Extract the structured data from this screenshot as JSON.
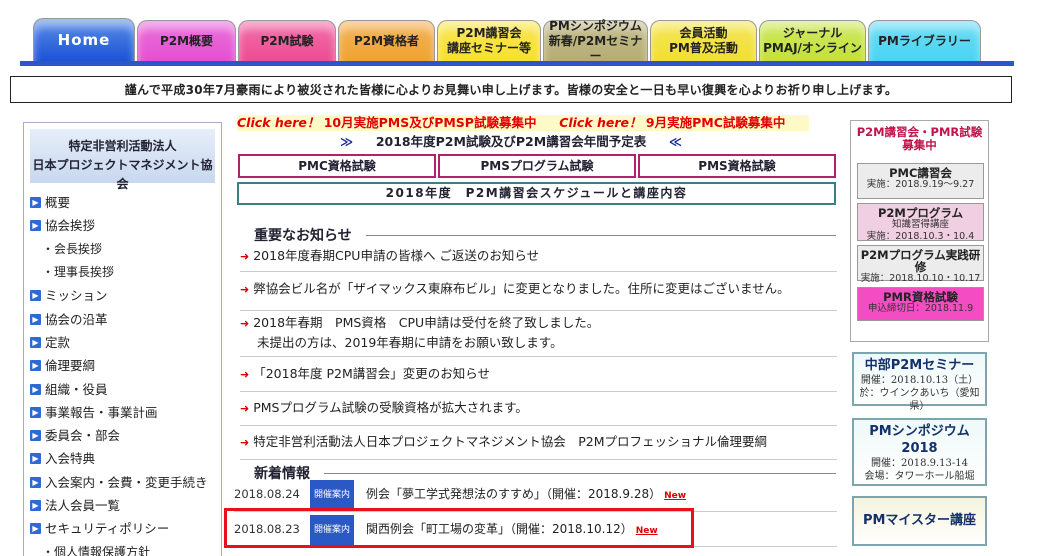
{
  "nav": {
    "tabs": [
      {
        "l1": "Home",
        "l2": "",
        "color": "#1c52d6"
      },
      {
        "l1": "P2M概要",
        "l2": "",
        "color": "#e44fd2"
      },
      {
        "l1": "P2M試験",
        "l2": "",
        "color": "#ee4c93"
      },
      {
        "l1": "P2M資格者",
        "l2": "",
        "color": "#f0a232"
      },
      {
        "l1": "P2M講習会",
        "l2": "講座セミナー等",
        "color": "#f7e02d"
      },
      {
        "l1": "PMシンポジウム",
        "l2": "新春/P2Mセミナー",
        "color": "#b6ad74"
      },
      {
        "l1": "会員活動",
        "l2": "PM普及活動",
        "color": "#f2df32"
      },
      {
        "l1": "ジャーナル",
        "l2": "PMAJ/オンライン",
        "color": "#c2e23a"
      },
      {
        "l1": "PMライブラリー",
        "l2": "",
        "color": "#49d4f3"
      }
    ]
  },
  "notice": "謹んで平成30年7月豪雨により被災された皆様に心よりお見舞い申し上げます。皆様の安全と一日も早い復興を心よりお祈り申し上げます。",
  "sidebar": {
    "org1": "特定非営利活動法人",
    "org2": "日本プロジェクトマネジメント協会",
    "items": [
      {
        "label": "概要",
        "sub": false
      },
      {
        "label": "協会挨拶",
        "sub": false
      },
      {
        "label": "・会長挨拶",
        "sub": true
      },
      {
        "label": "・理事長挨拶",
        "sub": true
      },
      {
        "label": "ミッション",
        "sub": false
      },
      {
        "label": "協会の沿革",
        "sub": false
      },
      {
        "label": "定款",
        "sub": false
      },
      {
        "label": "倫理要綱",
        "sub": false
      },
      {
        "label": "組織・役員",
        "sub": false
      },
      {
        "label": "事業報告・事業計画",
        "sub": false
      },
      {
        "label": "委員会・部会",
        "sub": false
      },
      {
        "label": "入会特典",
        "sub": false
      },
      {
        "label": "入会案内・会費・変更手続き",
        "sub": false
      },
      {
        "label": "法人会員一覧",
        "sub": false
      },
      {
        "label": "セキュリティポリシー",
        "sub": false
      },
      {
        "label": "・個人情報保護方針",
        "sub": true
      }
    ]
  },
  "center": {
    "click1": "Click here！",
    "click1_text": "10月実施PMS及びPMSP試験募集中",
    "click2": "Click here！",
    "click2_text": "9月実施PMC試験募集中",
    "schedule": "2018年度P2M試験及びP2M講習会年間予定表",
    "exams": [
      "PMC資格試験",
      "PMSプログラム試験",
      "PMS資格試験"
    ],
    "schedbar": "2018年度　P2M講習会スケジュールと講座内容",
    "important_title": "重要なお知らせ",
    "important": [
      [
        "2018年度春期CPU申請の皆様へ ご返送のお知らせ"
      ],
      [
        "弊協会ビル名が「ザイマックス東麻布ビル」に変更となりました。住所に変更はございません。"
      ],
      [
        "2018年春期　PMS資格　CPU申請は受付を終了致しました。",
        "未提出の方は、2019年春期に申請をお願い致します。"
      ],
      [
        "「2018年度 P2M講習会」変更のお知らせ"
      ],
      [
        "PMSプログラム試験の受験資格が拡大されます。"
      ],
      [
        "特定非営利活動法人日本プロジェクトマネジメント協会　P2Mプロフェッショナル倫理要綱"
      ]
    ],
    "news_title": "新着情報",
    "news": [
      {
        "date": "2018.08.24",
        "badge": "開催案内",
        "title": "例会「夢工学式発想法のすすめ」（開催：2018.9.28）",
        "new": "New"
      },
      {
        "date": "2018.08.23",
        "badge": "開催案内",
        "title": "関西例会「町工場の変革」（開催：2018.10.12）",
        "new": "New"
      }
    ]
  },
  "right": {
    "head1": "P2M講習会・PMR試験",
    "head2": "募集中",
    "boxes": [
      {
        "title": "PMC講習会",
        "lines": [
          "実施：2018.9.19～9.27"
        ]
      },
      {
        "title": "P2Mプログラム",
        "lines": [
          "知識習得講座",
          "実施：2018.10.3・10.4"
        ]
      },
      {
        "title": "P2Mプログラム実践研修",
        "lines": [
          "実施：2018.10.10・10.17"
        ]
      },
      {
        "title": "PMR資格試験",
        "lines": [
          "申込締切日：2018.11.9"
        ]
      }
    ],
    "ads": [
      {
        "title": "中部P2Mセミナー",
        "lines": [
          "開催：2018.10.13（土）",
          "於：ウインクあいち（愛知県）"
        ]
      },
      {
        "title": "PMシンポジウム",
        "title2": "2018",
        "lines": [
          "開催：2018.9.13-14",
          "会場：タワーホール船堀"
        ]
      },
      {
        "title": "PMマイスター講座",
        "lines": []
      }
    ]
  }
}
